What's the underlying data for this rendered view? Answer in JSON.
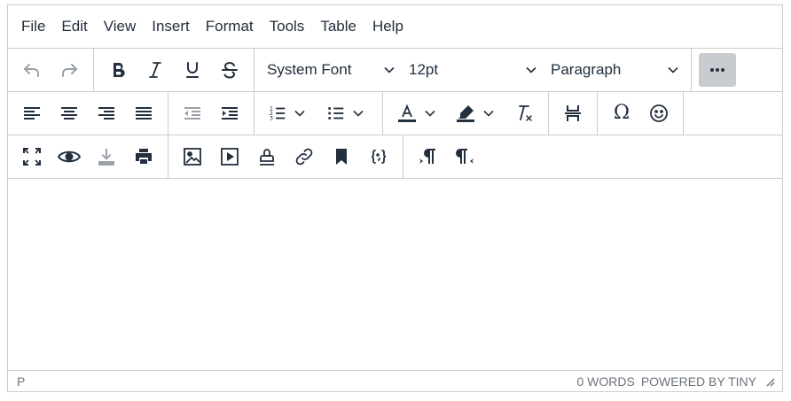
{
  "menubar": {
    "items": [
      "File",
      "Edit",
      "View",
      "Insert",
      "Format",
      "Tools",
      "Table",
      "Help"
    ]
  },
  "toolbar": {
    "font_family": "System Font",
    "font_size": "12pt",
    "block_format": "Paragraph",
    "special_char_glyph": "Ω",
    "icons": {
      "undo": "undo-icon",
      "redo": "redo-icon",
      "bold": "bold-icon",
      "italic": "italic-icon",
      "underline": "underline-icon",
      "strikethrough": "strikethrough-icon",
      "more": "more-icon",
      "align_left": "align-left-icon",
      "align_center": "align-center-icon",
      "align_right": "align-right-icon",
      "justify": "align-justify-icon",
      "outdent": "outdent-icon",
      "indent": "indent-icon",
      "numbered_list": "numbered-list-icon",
      "bullet_list": "bullet-list-icon",
      "text_color": "text-color-icon",
      "highlight": "highlight-icon",
      "clear_format": "clear-formatting-icon",
      "page_break": "page-break-icon",
      "special_char": "omega-icon",
      "emoji": "emoji-icon",
      "fullscreen": "fullscreen-icon",
      "preview": "preview-eye-icon",
      "save": "save-download-icon",
      "print": "print-icon",
      "image": "image-icon",
      "media": "media-icon",
      "template": "stamp-icon",
      "link": "link-icon",
      "anchor": "bookmark-icon",
      "code": "code-sample-icon",
      "ltr": "ltr-icon",
      "rtl": "rtl-icon"
    }
  },
  "colors": {
    "text_color_bar": "#222f3e",
    "highlight_bar": "#222f3e",
    "border": "#cccccc",
    "disabled": "#9aa0a8",
    "active_bg": "#c8cbcf"
  },
  "statusbar": {
    "path": "P",
    "word_count": "0 WORDS",
    "branding": "POWERED BY TINY"
  }
}
